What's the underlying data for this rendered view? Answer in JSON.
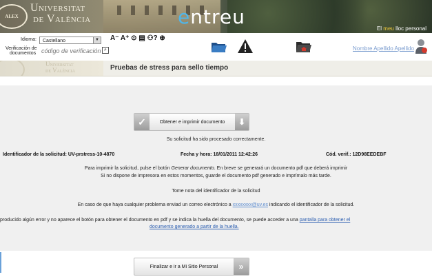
{
  "banner": {
    "university_line1": "Universitat",
    "university_line2": "de València",
    "seal_text": "ALEX",
    "app_name_e": "e",
    "app_name_rest": "ntreu",
    "bloc_prefix": "El ",
    "bloc_meu": "meu",
    "bloc_suffix": " lloc personal"
  },
  "toolbar": {
    "language_label": "Idioma:",
    "language_value": "Castellano",
    "verification_label_1": "Verificación de",
    "verification_label_2": "documentos",
    "verification_placeholder": "código de verificación",
    "text_tools": "A⁻ A⁺ ⊙ ▤ ⚇? ⊕",
    "user_name": "Nombre Apellido Apellido"
  },
  "titlebar": {
    "logo_line1": "Universitat",
    "logo_line2": "de València",
    "title": "Pruebas de stress para sello tiempo"
  },
  "main": {
    "generate_button": "Obtener e imprimir documento",
    "status": "Su solicitud ha sido procesado correctamente.",
    "request_id": "Identificador de la solicitud: UV-prstress-10-4870",
    "datetime": "Fecha y hora: 18/01/2011 12:42:26",
    "verification_code": "Cód. verif.: 12D98EEDEBF",
    "print_line1_a": "Para imprimir la solicitud, pulse el botón ",
    "print_line1_em": "Generar documento",
    "print_line1_b": ". En breve se generará un documento pdf que deberá imprimir",
    "print_line2": "Si no dispone de impresora en estos momentos, guarde el documento pdf generado e imprímalo más tarde.",
    "note": "Tome nota del identificador de la solicitud",
    "problem_a": "En caso de que haya cualquier problema enviad un correo electrónico a ",
    "problem_email": "xxxxxxxx@uv.es",
    "problem_b": " indicando el identificador de la solicitud.",
    "error_a": "producido algún error y no aparece el botón para obtener el documento en pdf y se indica la huella del documento, se puede acceder a una ",
    "error_link1": "pantalla para obtener el",
    "error_link2": "documento generado a partir de la huella.",
    "finish_button": "Finalizar e ir a Mi Sitio Personal"
  }
}
